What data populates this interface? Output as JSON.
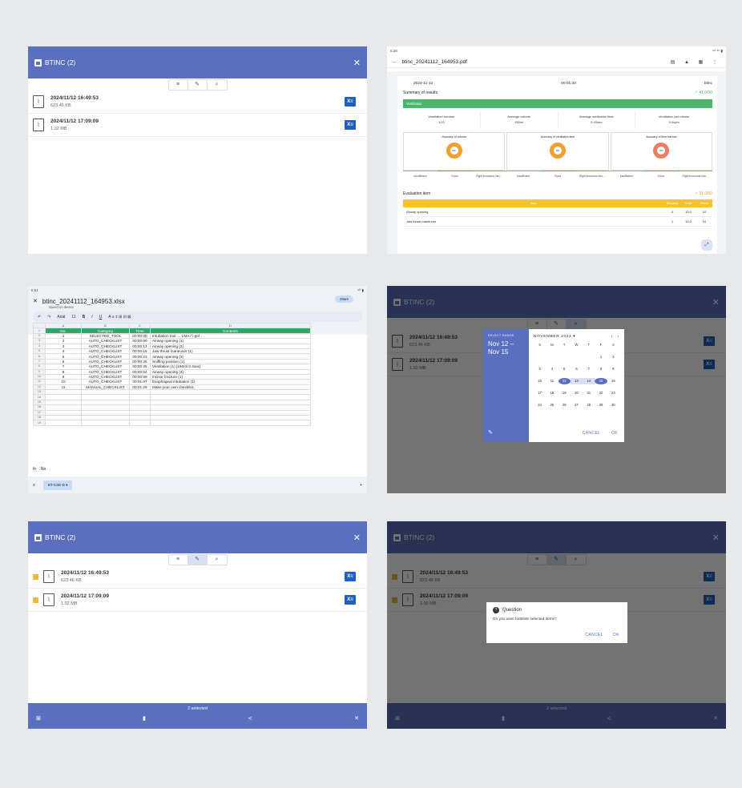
{
  "app": {
    "title": "BTINC (2)",
    "close": "✕",
    "toolbar": {
      "sort": "≡",
      "edit": "✎",
      "search": "⌕"
    },
    "files": [
      {
        "name": "2024/11/12 16:49:53",
        "size": "623.46 KB"
      },
      {
        "name": "2024/11/12 17:09:09",
        "size": "1.02 MB"
      }
    ],
    "excel_icon": "X≡"
  },
  "pdf": {
    "status_time": "5:28",
    "status_right": "⁴ᴳ ⁸⁵ ▮",
    "filename": "btinc_20241112_164953.pdf",
    "date": "2024-11-12",
    "duration": "00:01:33",
    "user": "btinc",
    "summary_label": "Summary of results",
    "summary_score": "✓ 41.0/90",
    "ventilation_label": "Ventilation",
    "metrics": [
      {
        "label": "Ventilation number",
        "value": "1/10"
      },
      {
        "label": "Average volume",
        "value": "150ml"
      },
      {
        "label": "Average ventilation time",
        "value": "0.4Ssec"
      },
      {
        "label": "Ventilation per minute",
        "value": "0.0vpm"
      }
    ],
    "accuracy": [
      {
        "label": "Accuracy of volume",
        "value": "0%"
      },
      {
        "label": "Accuracy of ventilation time",
        "value": "0%"
      },
      {
        "label": "Accuracy of time interval",
        "value": "0%"
      }
    ],
    "categories": [
      "Insufficient",
      "Good",
      "Right bronchus intu...",
      "Insufficient",
      "Good",
      "Right bronchus intu...",
      "Insufficient",
      "Good",
      "Right bronchus intu..."
    ],
    "eval_label": "Evaluation item",
    "eval_score": "✓ 31.0/80",
    "eval_headers": {
      "item": "Item",
      "remarks": "Remarks",
      "scale": "Scale",
      "points": "Points"
    },
    "eval_items": [
      {
        "item": "Airway opening",
        "remarks": "4",
        "scale": "10.0",
        "points": "10"
      },
      {
        "item": "Jaw thrust maneuver",
        "remarks": "1",
        "scale": "10.0",
        "points": "10"
      }
    ]
  },
  "sheet": {
    "status_time": "5:01",
    "filename": "btinc_20241112_164953.xlsx",
    "saved": "Saved on device",
    "share": "Share",
    "font": "Arial",
    "font_size": "11",
    "col_letters": [
      "A",
      "B",
      "C",
      "D"
    ],
    "headers": [
      "No.",
      "Category",
      "Time",
      "Contents"
    ],
    "rows": [
      [
        "1",
        "SELECTED_TOOL",
        "00:00:00",
        "Intubation tool → LMA / i-gel"
      ],
      [
        "2",
        "AUTO_CHECKLIST",
        "00:00:00",
        "Airway opening (1)"
      ],
      [
        "3",
        "AUTO_CHECKLIST",
        "00:00:13",
        "Airway opening (2)"
      ],
      [
        "4",
        "AUTO_CHECKLIST",
        "00:00:15",
        "Jaw thrust maneuver (1)"
      ],
      [
        "5",
        "AUTO_CHECKLIST",
        "00:00:23",
        "Airway opening (3)"
      ],
      [
        "6",
        "AUTO_CHECKLIST",
        "00:00:26",
        "Sniffing position (1)"
      ],
      [
        "7",
        "AUTO_CHECKLIST",
        "00:00:35",
        "Ventilation (1) [150ml 0.4sec]"
      ],
      [
        "8",
        "AUTO_CHECKLIST",
        "00:00:54",
        "Airway opening (4)"
      ],
      [
        "9",
        "AUTO_CHECKLIST",
        "00:00:59",
        "Incisor fracture (1)"
      ],
      [
        "10",
        "AUTO_CHECKLIST",
        "00:01:07",
        "Esophageal intubation (1)"
      ],
      [
        "11",
        "MANUAL_CHECKLIST",
        "00:01:29",
        "Make your own checklist."
      ]
    ],
    "formula": "No.",
    "sheet_tab": "BT-CSE-D ▾"
  },
  "calendar": {
    "select_label": "SELECT RANGE",
    "range": "Nov 12 – Nov 15",
    "month": "NOVEMBER 2024 ▾",
    "weekdays": [
      "S",
      "M",
      "T",
      "W",
      "T",
      "F",
      "S"
    ],
    "cancel": "CANCEL",
    "ok": "OK"
  },
  "selection": {
    "count": "2 selected",
    "question_title": "Question",
    "question_text": "Do you want todelete selected items?",
    "cancel": "CANCEL",
    "ok": "OK"
  },
  "colors": {
    "accent": "#5a6fbd",
    "green": "#49b66b",
    "yellow": "#f6c232",
    "orange": "#f0a030"
  }
}
